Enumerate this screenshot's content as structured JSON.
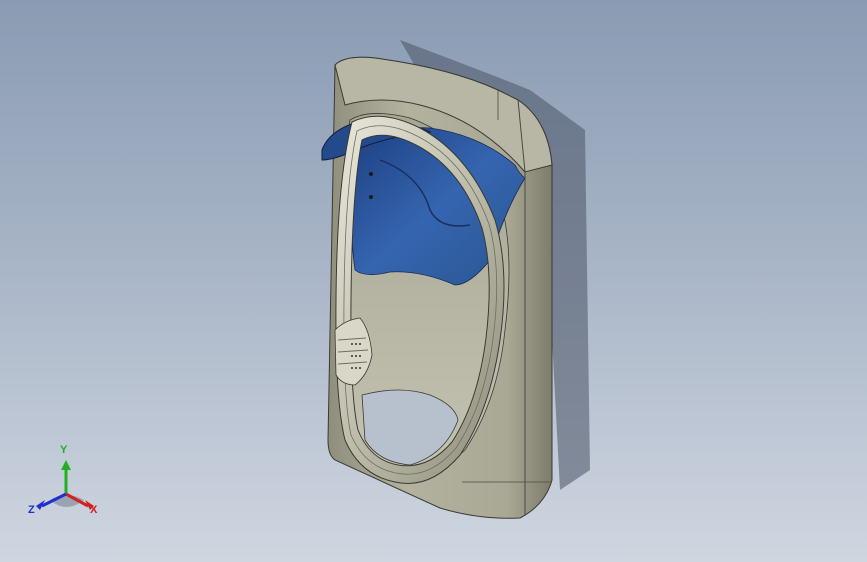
{
  "viewport": {
    "background_top": "#8a9bb3",
    "background_bottom": "#cfd6e0",
    "model": {
      "shell_color": "#a7a693",
      "inner_color": "#2e5da8",
      "edge_color": "#3a3a34"
    }
  },
  "triad": {
    "x_label": "X",
    "y_label": "Y",
    "z_label": "Z",
    "x_color": "#d42020",
    "y_color": "#22b022",
    "z_color": "#2030d0"
  }
}
